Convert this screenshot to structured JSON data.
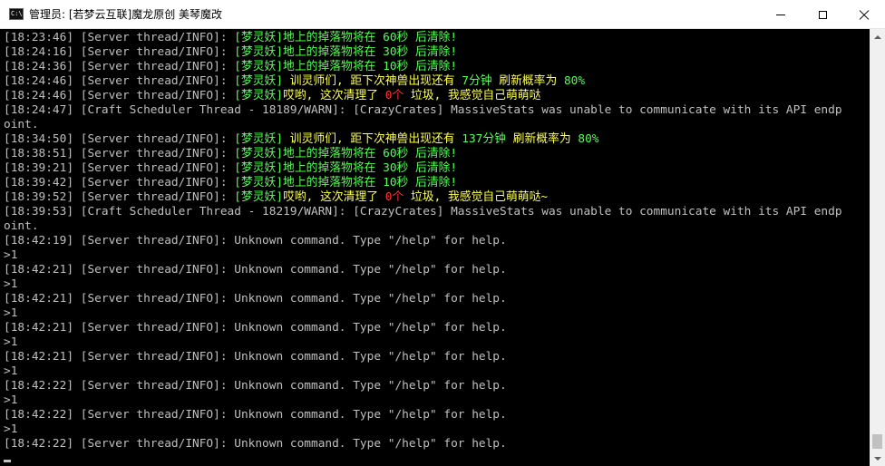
{
  "window": {
    "icon_text": "C:\\.",
    "title": "管理员:  [若梦云互联]魔龙原创 美琴魔改"
  },
  "console": {
    "lines": [
      [
        [
          "[18:23:46] [Server thread/INFO]: ",
          "white"
        ],
        [
          "[梦灵妖]地上的掉落物将在 60秒 后清除!",
          "green"
        ]
      ],
      [
        [
          "[18:24:16] [Server thread/INFO]: ",
          "white"
        ],
        [
          "[梦灵妖]地上的掉落物将在 30秒 后清除!",
          "green"
        ]
      ],
      [
        [
          "[18:24:36] [Server thread/INFO]: ",
          "white"
        ],
        [
          "[梦灵妖]地上的掉落物将在 10秒 后清除!",
          "green"
        ]
      ],
      [
        [
          "[18:24:46] [Server thread/INFO]: ",
          "white"
        ],
        [
          "[梦灵妖] ",
          "green"
        ],
        [
          "训灵师们, 距下次神兽出现还有 ",
          "yellow"
        ],
        [
          "7分钟 ",
          "green"
        ],
        [
          "刷新概率为 ",
          "yellow"
        ],
        [
          "80%",
          "green"
        ]
      ],
      [
        [
          "[18:24:46] [Server thread/INFO]: ",
          "white"
        ],
        [
          "[梦灵妖]",
          "green"
        ],
        [
          "哎哟, 这次清理了 ",
          "yellow"
        ],
        [
          "0个 ",
          "red"
        ],
        [
          "垃圾, 我感觉自己萌萌哒",
          "yellow"
        ]
      ],
      [
        [
          "[18:24:47] [Craft Scheduler Thread - 18189/WARN]: [CrazyCrates] MassiveStats was unable to communicate with its API endp",
          "white"
        ]
      ],
      [
        [
          "oint.",
          "white"
        ]
      ],
      [
        [
          "[18:34:50] [Server thread/INFO]: ",
          "white"
        ],
        [
          "[梦灵妖] ",
          "green"
        ],
        [
          "训灵师们, 距下次神兽出现还有 ",
          "yellow"
        ],
        [
          "137分钟 ",
          "green"
        ],
        [
          "刷新概率为 ",
          "yellow"
        ],
        [
          "80%",
          "green"
        ]
      ],
      [
        [
          "[18:38:51] [Server thread/INFO]: ",
          "white"
        ],
        [
          "[梦灵妖]地上的掉落物将在 60秒 后清除!",
          "green"
        ]
      ],
      [
        [
          "[18:39:21] [Server thread/INFO]: ",
          "white"
        ],
        [
          "[梦灵妖]地上的掉落物将在 30秒 后清除!",
          "green"
        ]
      ],
      [
        [
          "[18:39:42] [Server thread/INFO]: ",
          "white"
        ],
        [
          "[梦灵妖]地上的掉落物将在 10秒 后清除!",
          "green"
        ]
      ],
      [
        [
          "[18:39:52] [Server thread/INFO]: ",
          "white"
        ],
        [
          "[梦灵妖]",
          "green"
        ],
        [
          "哎哟, 这次清理了 ",
          "yellow"
        ],
        [
          "0个 ",
          "red"
        ],
        [
          "垃圾, 我感觉自己萌萌哒~",
          "yellow"
        ]
      ],
      [
        [
          "[18:39:53] [Craft Scheduler Thread - 18219/WARN]: [CrazyCrates] MassiveStats was unable to communicate with its API endp",
          "white"
        ]
      ],
      [
        [
          "oint.",
          "white"
        ]
      ],
      [
        [
          "[18:42:19] [Server thread/INFO]: Unknown command. Type \"/help\" for help.",
          "white"
        ]
      ],
      [
        [
          ">1",
          "white"
        ]
      ],
      [
        [
          "[18:42:21] [Server thread/INFO]: Unknown command. Type \"/help\" for help.",
          "white"
        ]
      ],
      [
        [
          ">1",
          "white"
        ]
      ],
      [
        [
          "[18:42:21] [Server thread/INFO]: Unknown command. Type \"/help\" for help.",
          "white"
        ]
      ],
      [
        [
          ">1",
          "white"
        ]
      ],
      [
        [
          "[18:42:21] [Server thread/INFO]: Unknown command. Type \"/help\" for help.",
          "white"
        ]
      ],
      [
        [
          ">1",
          "white"
        ]
      ],
      [
        [
          "[18:42:21] [Server thread/INFO]: Unknown command. Type \"/help\" for help.",
          "white"
        ]
      ],
      [
        [
          ">1",
          "white"
        ]
      ],
      [
        [
          "[18:42:22] [Server thread/INFO]: Unknown command. Type \"/help\" for help.",
          "white"
        ]
      ],
      [
        [
          ">1",
          "white"
        ]
      ],
      [
        [
          "[18:42:22] [Server thread/INFO]: Unknown command. Type \"/help\" for help.",
          "white"
        ]
      ],
      [
        [
          ">1",
          "white"
        ]
      ],
      [
        [
          "[18:42:22] [Server thread/INFO]: Unknown command. Type \"/help\" for help.",
          "white"
        ]
      ]
    ]
  }
}
